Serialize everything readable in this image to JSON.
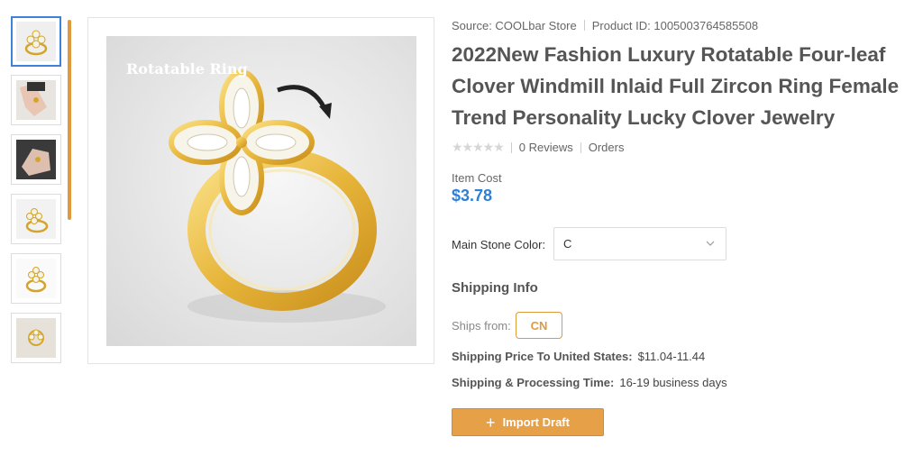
{
  "product": {
    "source_label": "Source: COOLbar Store",
    "product_id_label": "Product ID: 1005003764585508",
    "title": "2022New Fashion Luxury Rotatable Four-leaf Clover Windmill Inlaid Full Zircon Ring Female Trend Personality Lucky Clover Jewelry",
    "reviews": "0 Reviews",
    "orders": "Orders",
    "rating_stars": 0,
    "item_cost_label": "Item Cost",
    "price": "$3.78",
    "image_caption": "Rotatable Ring"
  },
  "options": {
    "main_stone_label": "Main Stone Color:",
    "main_stone_value": "C"
  },
  "shipping": {
    "title": "Shipping Info",
    "ships_from_label": "Ships from:",
    "ships_from_value": "CN",
    "price_label": "Shipping Price To United States:",
    "price_value": "$11.04-11.44",
    "time_label": "Shipping & Processing Time:",
    "time_value": "16-19 business days"
  },
  "actions": {
    "import_label": "Import Draft"
  },
  "colors": {
    "accent": "#e5a048",
    "price": "#2f7fd8",
    "thumb_active": "#3c82d6"
  }
}
